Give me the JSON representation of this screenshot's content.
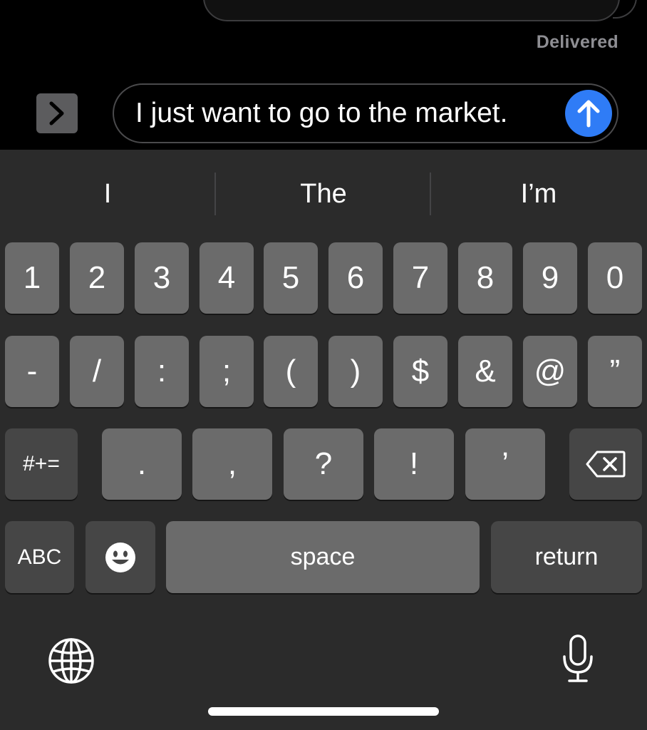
{
  "conversation": {
    "status": "Delivered"
  },
  "composer": {
    "message_text": "I just want to go to the market."
  },
  "suggestions": [
    "I",
    "The",
    "I’m"
  ],
  "keyboard": {
    "number_row": [
      "1",
      "2",
      "3",
      "4",
      "5",
      "6",
      "7",
      "8",
      "9",
      "0"
    ],
    "symbol_row": [
      "-",
      "/",
      ":",
      ";",
      "(",
      ")",
      "$",
      "&",
      "@",
      "”"
    ],
    "punct_row": {
      "shift_label": "#+=",
      "keys": [
        ".",
        ",",
        "?",
        "!",
        "’"
      ]
    },
    "bottom_row": {
      "abc_label": "ABC",
      "space_label": "space",
      "return_label": "return"
    }
  },
  "colors": {
    "send_button": "#2f7cf6",
    "key": "#6b6b6b",
    "key_dark": "#464646",
    "keyboard_bg": "#2b2b2b"
  }
}
